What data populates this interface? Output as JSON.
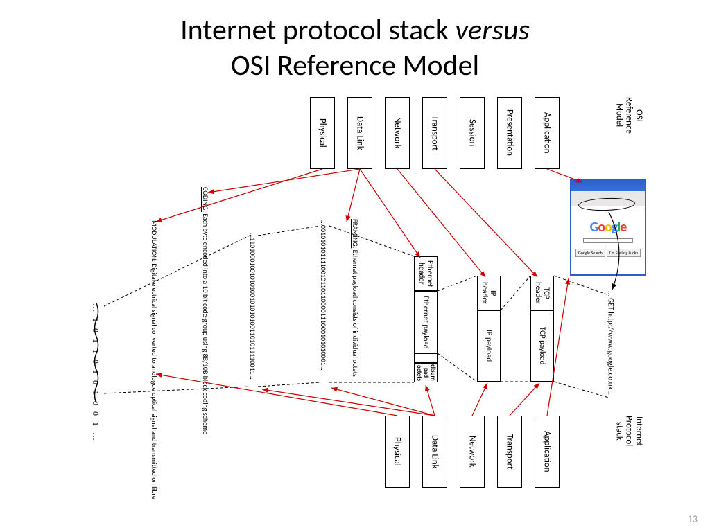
{
  "title": {
    "part1": "Internet protocol stack ",
    "italic": "versus",
    "part2": "OSI Reference Model"
  },
  "pageNumber": "13",
  "osi": {
    "label": "OSI\nReference\nModel",
    "layers": [
      "Application",
      "Presentation",
      "Session",
      "Transport",
      "Network",
      "Data Link",
      "Physical"
    ]
  },
  "internet": {
    "label": "Internet\nProtocol\nstack",
    "layers": [
      "Application",
      "Transport",
      "Network",
      "Data Link",
      "Physical"
    ]
  },
  "httpRequest": "… GET http://www.google.co.uk …",
  "tcp": {
    "header": "TCP header",
    "payload": "TCP payload"
  },
  "ip": {
    "header": "IP header",
    "payload": "IP payload"
  },
  "eth": {
    "header": "Ethernet header",
    "payload": "Ethernet payload",
    "cksum": "cksum",
    "pad": "pad",
    "octets": "octets"
  },
  "framing": {
    "title": "FRAMING:",
    "text": " Ethernet payload consists of individual octets"
  },
  "coding": {
    "title": "CODING:",
    "text": " Each byte encoded into a 10 bit code-group using 8B/10B block coding scheme"
  },
  "modulation": {
    "title": "MODULATION:",
    "text": " Digital electrical signal converted to anologue optical signal and transmitted on fibre"
  },
  "bits1": "…0010101011110010110110000111000101010001…",
  "bits2": "…110100010010101001010101001101011110011…",
  "wave": "… 1 0 1 1 0 1 0 1 0 0 1 …",
  "google": {
    "btn1": "Google Search",
    "btn2": "I'm Feeling Lucky"
  }
}
